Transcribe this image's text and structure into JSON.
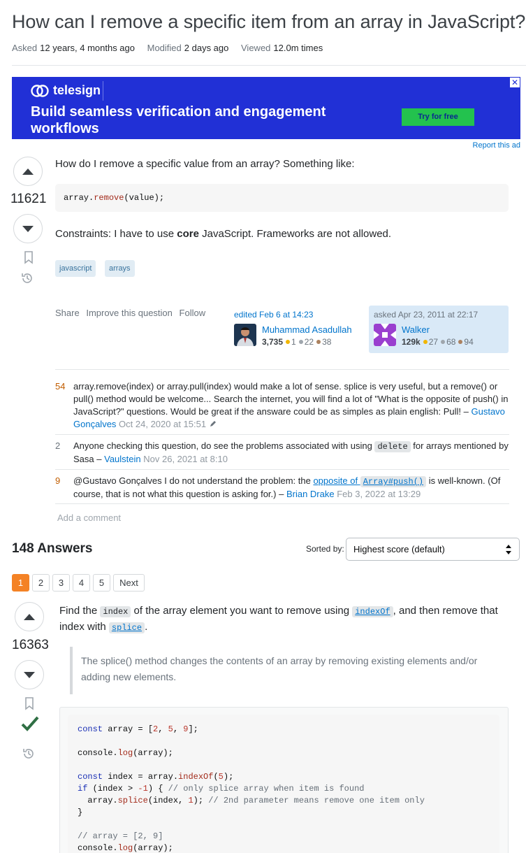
{
  "question": {
    "title": "How can I remove a specific item from an array in JavaScript?",
    "asked_label": "Asked",
    "asked_value": "12 years, 4 months ago",
    "modified_label": "Modified",
    "modified_value": "2 days ago",
    "viewed_label": "Viewed",
    "viewed_value": "12.0m times",
    "score": "11621",
    "body_intro": "How do I remove a specific value from an array? Something like:",
    "code": {
      "obj": "array.",
      "fn": "remove",
      "rest": "(value);"
    },
    "constraints_before": "Constraints: I have to use ",
    "constraints_bold": "core",
    "constraints_after": " JavaScript. Frameworks are not allowed.",
    "tags": [
      "javascript",
      "arrays"
    ],
    "menu": {
      "share": "Share",
      "improve": "Improve this question",
      "follow": "Follow"
    },
    "editor": {
      "action": "edited Feb 6 at 14:23",
      "name": "Muhammad Asadullah",
      "rep": "3,735",
      "gold": "1",
      "silver": "22",
      "bronze": "38"
    },
    "owner": {
      "action": "asked Apr 23, 2011 at 22:17",
      "name": "Walker",
      "rep": "129k",
      "gold": "27",
      "silver": "68",
      "bronze": "94"
    }
  },
  "comments": [
    {
      "score": "54",
      "text": "array.remove(index) or array.pull(index) would make a lot of sense. splice is very useful, but a remove() or pull() method would be welcome... Search the internet, you will find a lot of \"What is the opposite of push() in JavaScript?\" questions. Would be great if the answare could be as simples as plain english: Pull!",
      "sep": " – ",
      "user": "Gustavo Gonçalves",
      "date": "Oct 24, 2020 at 15:51"
    },
    {
      "score": "2",
      "text_before": "Anyone checking this question, do see the problems associated with using ",
      "code": "delete",
      "text_after": " for arrays mentioned by Sasa",
      "sep": " – ",
      "user": "Vaulstein",
      "date": "Nov 26, 2021 at 8:10"
    },
    {
      "score": "9",
      "text_before": "@Gustavo Gonçalves I do not understand the problem: the ",
      "link_text": "opposite of",
      "link_code": "Array#push()",
      "text_after": " is well-known. (Of course, that is not what this question is asking for.)",
      "sep": " – ",
      "user": "Brian Drake",
      "date": "Feb 3, 2022 at 13:29"
    }
  ],
  "add_comment": "Add a comment",
  "answers_header": {
    "count": "148 Answers",
    "sorted_label": "Sorted by:",
    "sort_value": "Highest score (default)",
    "pages": [
      "1",
      "2",
      "3",
      "4",
      "5"
    ],
    "next": "Next"
  },
  "answer": {
    "score": "16363",
    "p1_a": "Find the ",
    "p1_code": "index",
    "p1_b": " of the array element you want to remove using ",
    "p1_link": "indexOf",
    "p1_c": ", and then remove that index with ",
    "p1_link2": "splice",
    "p1_d": ".",
    "quote": "The splice() method changes the contents of an array by removing existing elements and/or adding new elements.",
    "code_lines": [
      "const array = [2, 5, 9];",
      "",
      "console.log(array);",
      "",
      "const index = array.indexOf(5);",
      "if (index > -1) { // only splice array when item is found",
      "  array.splice(index, 1); // 2nd parameter means remove one item only",
      "}",
      "",
      "// array = [2, 9]",
      "console.log(array);"
    ]
  },
  "ad": {
    "brand": "telesign",
    "headline": "Build seamless verification and engagement workflows",
    "cta": "Try for free",
    "close": "✕",
    "report": "Report this ad"
  },
  "colors": {
    "accent": "#0074cc",
    "orange": "#f48225",
    "accepted": "#2f6f44",
    "ad_bg": "#2130d6"
  }
}
